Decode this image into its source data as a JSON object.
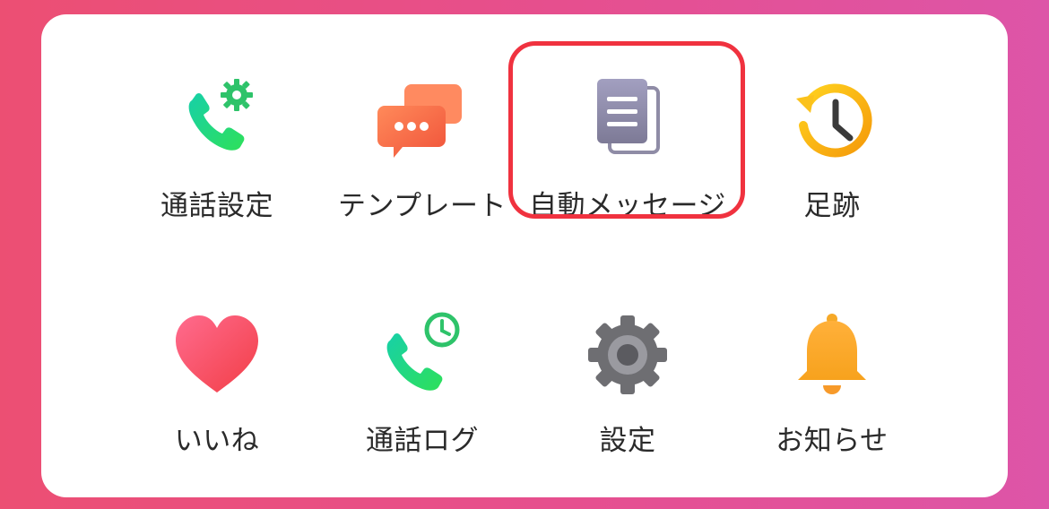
{
  "colors": {
    "background_left": "#ec4f73",
    "background_right": "#dd55a8",
    "card": "#ffffff",
    "highlight": "#f0323f"
  },
  "menu": {
    "items": [
      {
        "label": "通話設定",
        "icon": "phone-settings-icon"
      },
      {
        "label": "テンプレート",
        "icon": "chat-bubbles-icon"
      },
      {
        "label": "自動メッセージ",
        "icon": "documents-icon",
        "highlighted": true
      },
      {
        "label": "足跡",
        "icon": "history-clock-icon"
      },
      {
        "label": "いいね",
        "icon": "heart-icon"
      },
      {
        "label": "通話ログ",
        "icon": "phone-clock-icon"
      },
      {
        "label": "設定",
        "icon": "gear-icon"
      },
      {
        "label": "お知らせ",
        "icon": "bell-icon"
      }
    ]
  }
}
